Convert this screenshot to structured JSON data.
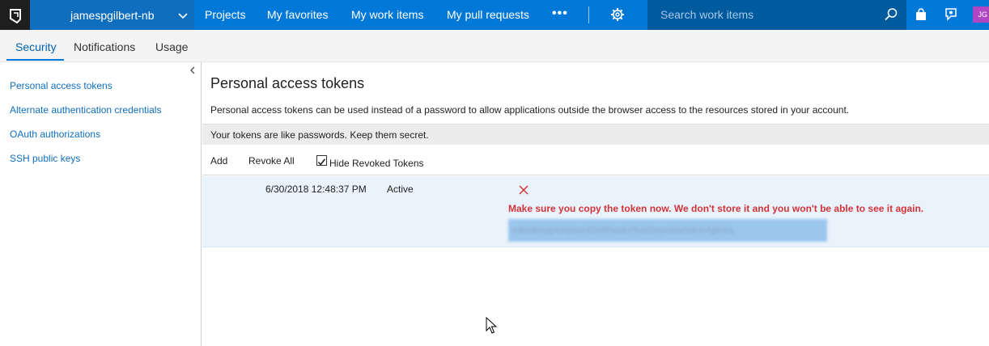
{
  "topbar": {
    "account_name": "jamespgilbert-nb",
    "nav": [
      {
        "label": "Projects"
      },
      {
        "label": "My favorites"
      },
      {
        "label": "My work items"
      },
      {
        "label": "My pull requests"
      }
    ],
    "more_label": "•••",
    "search_placeholder": "Search work items",
    "avatar_initials": "JG"
  },
  "tabs": [
    {
      "label": "Security",
      "active": true
    },
    {
      "label": "Notifications",
      "active": false
    },
    {
      "label": "Usage",
      "active": false
    }
  ],
  "sidebar": {
    "items": [
      {
        "label": "Personal access tokens"
      },
      {
        "label": "Alternate authentication credentials"
      },
      {
        "label": "OAuth authorizations"
      },
      {
        "label": "SSH public keys"
      }
    ]
  },
  "main": {
    "title": "Personal access tokens",
    "description": "Personal access tokens can be used instead of a password to allow applications outside the browser access to the resources stored in your account.",
    "warning": "Your tokens are like passwords. Keep them secret.",
    "toolbar": {
      "add_label": "Add",
      "revoke_all_label": "Revoke All",
      "hide_revoked_label": "Hide Revoked Tokens",
      "hide_revoked_checked": true
    },
    "token": {
      "date": "6/30/2018 12:48:37 PM",
      "status": "Active",
      "copy_message": "Make sure you copy the token now. We don't store it and you won't be able to see it again.",
      "value": "xqlizdkeyjpkdqovyufZwlfNwdu7kxd2wycd2q5dk4vfgtkikq"
    }
  },
  "colors": {
    "brand_blue": "#0078d7",
    "account_blue": "#106ebe",
    "search_blue": "#005a9e",
    "error_red": "#d13438",
    "row_highlight": "#eaf3fb"
  }
}
